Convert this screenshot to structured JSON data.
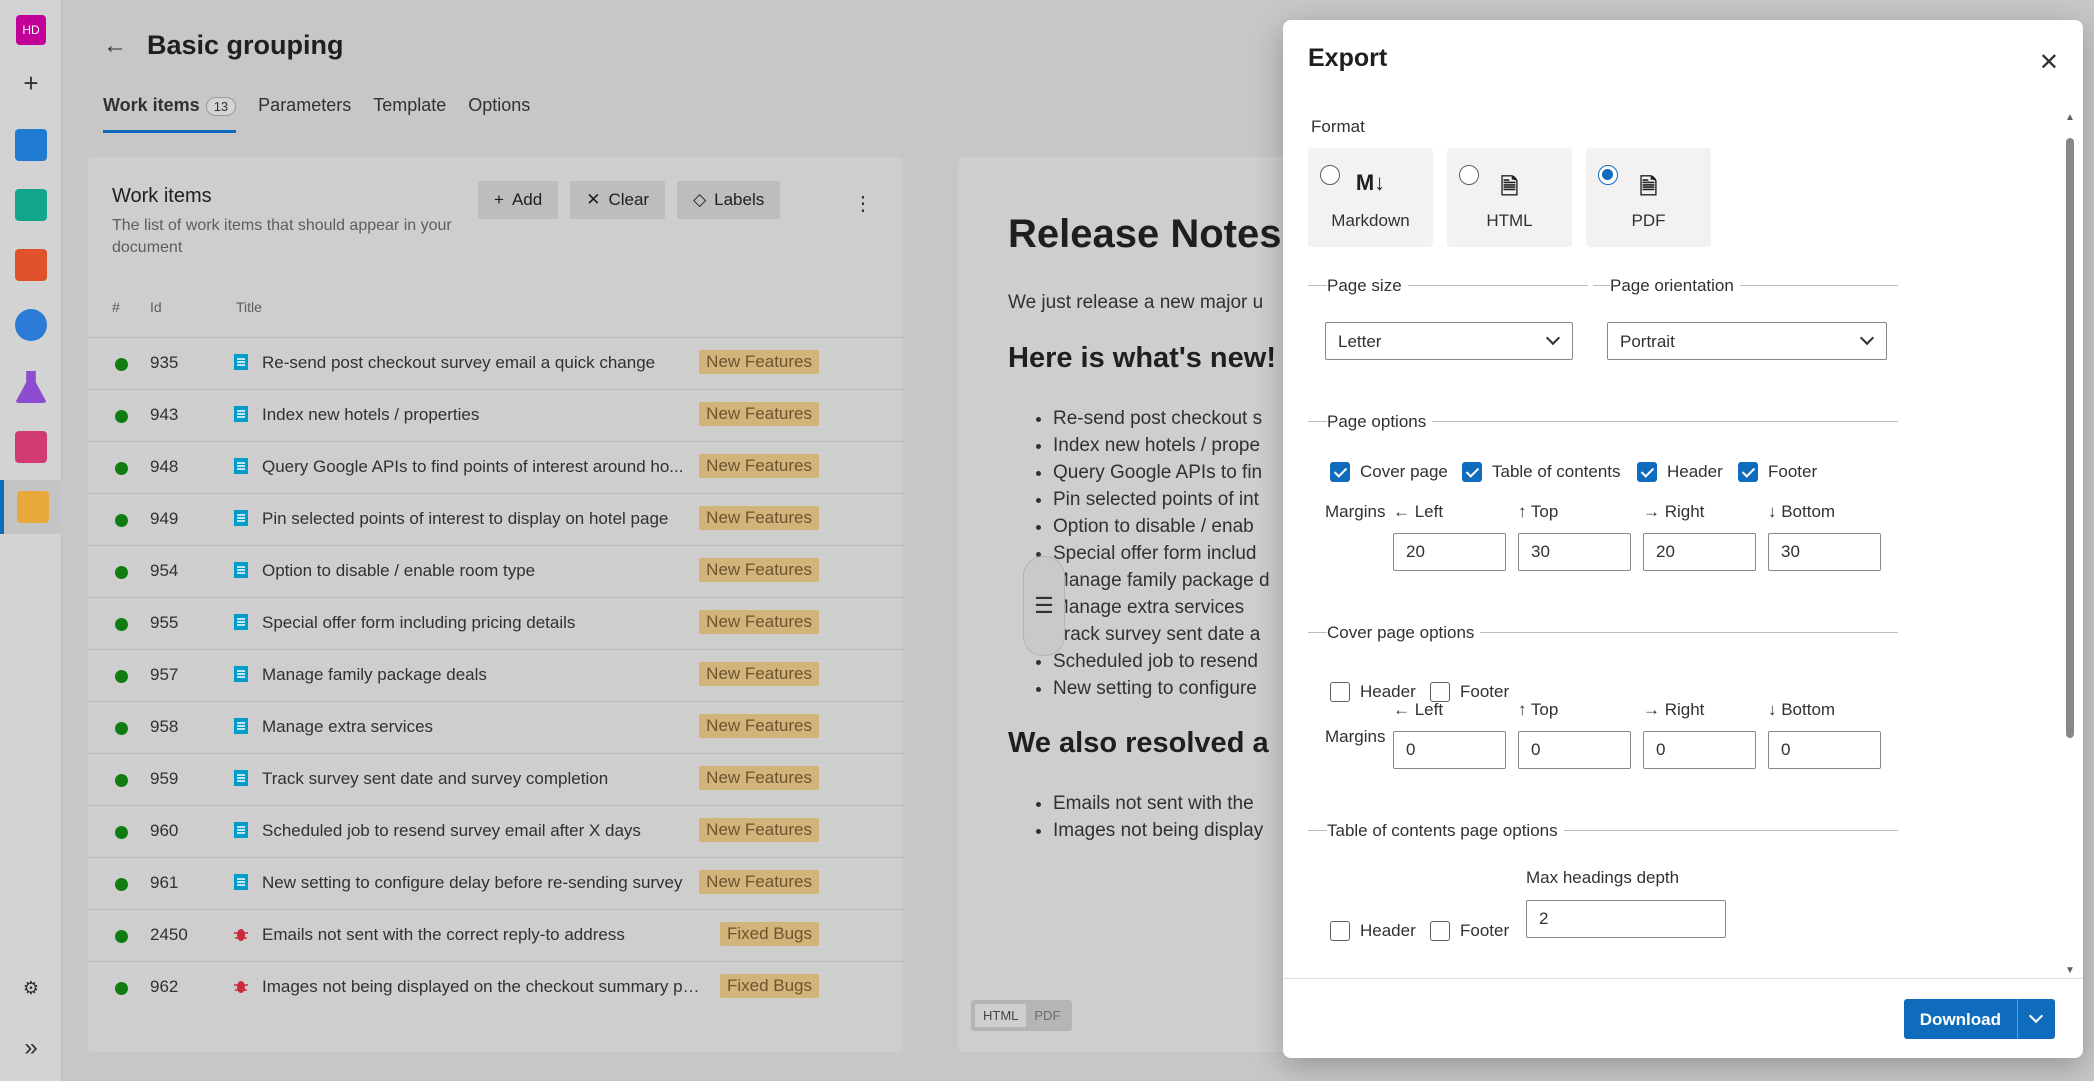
{
  "nav": {
    "avatar_initials": "HD",
    "plus_glyph": "+",
    "settings_glyph": "⚙",
    "expand_glyph": "»"
  },
  "page": {
    "title": "Basic grouping",
    "tabs": [
      {
        "label": "Work items",
        "badge": "13"
      },
      {
        "label": "Parameters"
      },
      {
        "label": "Template"
      },
      {
        "label": "Options"
      }
    ]
  },
  "work_items": {
    "title": "Work items",
    "description": "The list of work items that should appear in your document",
    "add_label": "Add",
    "clear_label": "Clear",
    "labels_label": "Labels",
    "columns": {
      "num": "#",
      "id": "Id",
      "title": "Title"
    },
    "rows": [
      {
        "id": "935",
        "title": "Re-send post checkout survey email a quick change",
        "tag": "New Features",
        "type": "story"
      },
      {
        "id": "943",
        "title": "Index new hotels / properties",
        "tag": "New Features",
        "type": "story"
      },
      {
        "id": "948",
        "title": "Query Google APIs to find points of interest around ho...",
        "tag": "New Features",
        "type": "story"
      },
      {
        "id": "949",
        "title": "Pin selected points of interest to display on hotel page",
        "tag": "New Features",
        "type": "story"
      },
      {
        "id": "954",
        "title": "Option to disable / enable room type",
        "tag": "New Features",
        "type": "story"
      },
      {
        "id": "955",
        "title": "Special offer form including pricing details",
        "tag": "New Features",
        "type": "story"
      },
      {
        "id": "957",
        "title": "Manage family package deals",
        "tag": "New Features",
        "type": "story"
      },
      {
        "id": "958",
        "title": "Manage extra services",
        "tag": "New Features",
        "type": "story"
      },
      {
        "id": "959",
        "title": "Track survey sent date and survey completion",
        "tag": "New Features",
        "type": "story"
      },
      {
        "id": "960",
        "title": "Scheduled job to resend survey email after X days",
        "tag": "New Features",
        "type": "story"
      },
      {
        "id": "961",
        "title": "New setting to configure delay before re-sending survey",
        "tag": "New Features",
        "type": "story"
      },
      {
        "id": "2450",
        "title": "Emails not sent with the correct reply-to address",
        "tag": "Fixed Bugs",
        "type": "bug"
      },
      {
        "id": "962",
        "title": "Images not being displayed on the checkout summary pa...",
        "tag": "Fixed Bugs",
        "type": "bug"
      }
    ]
  },
  "preview": {
    "h1": "Release Notes",
    "intro": "We just release a new major u",
    "h2_new": "Here is what's new!",
    "new_items": [
      "Re-send post checkout s",
      "Index new hotels / prope",
      "Query Google APIs to fin",
      "Pin selected points of int",
      "Option to disable / enab",
      "Special offer form includ",
      "Manage family package d",
      "Manage extra services",
      "Track survey sent date a",
      "Scheduled job to resend",
      "New setting to configure"
    ],
    "h2_fixed": "We also resolved a",
    "fixed_items": [
      "Emails not sent with the",
      "Images not being display"
    ],
    "toggle": [
      "HTML",
      "PDF"
    ]
  },
  "export": {
    "title": "Export",
    "format_label": "Format",
    "formats": [
      {
        "name": "Markdown",
        "icon": "M↓",
        "selected": false
      },
      {
        "name": "HTML",
        "icon": "🗎",
        "selected": false
      },
      {
        "name": "PDF",
        "icon": "🗎",
        "selected": true
      }
    ],
    "page_size_label": "Page size",
    "page_size_value": "Letter",
    "orientation_label": "Page orientation",
    "orientation_value": "Portrait",
    "page_options_label": "Page options",
    "page_options": [
      {
        "label": "Cover page",
        "checked": true
      },
      {
        "label": "Table of contents",
        "checked": true
      },
      {
        "label": "Header",
        "checked": true
      },
      {
        "label": "Footer",
        "checked": true
      }
    ],
    "margins_label": "Margins",
    "margin_names": {
      "left": "← Left",
      "top": "↑ Top",
      "right": "→ Right",
      "bottom": "↓ Bottom"
    },
    "page_margins": {
      "left": "20",
      "top": "30",
      "right": "20",
      "bottom": "30"
    },
    "cover_options_label": "Cover page options",
    "cover_header": "Header",
    "cover_footer": "Footer",
    "cover_margins": {
      "left": "0",
      "top": "0",
      "right": "0",
      "bottom": "0"
    },
    "toc_options_label": "Table of contents page options",
    "toc_header": "Header",
    "toc_footer": "Footer",
    "max_depth_label": "Max headings depth",
    "max_depth_value": "2",
    "download_label": "Download"
  }
}
